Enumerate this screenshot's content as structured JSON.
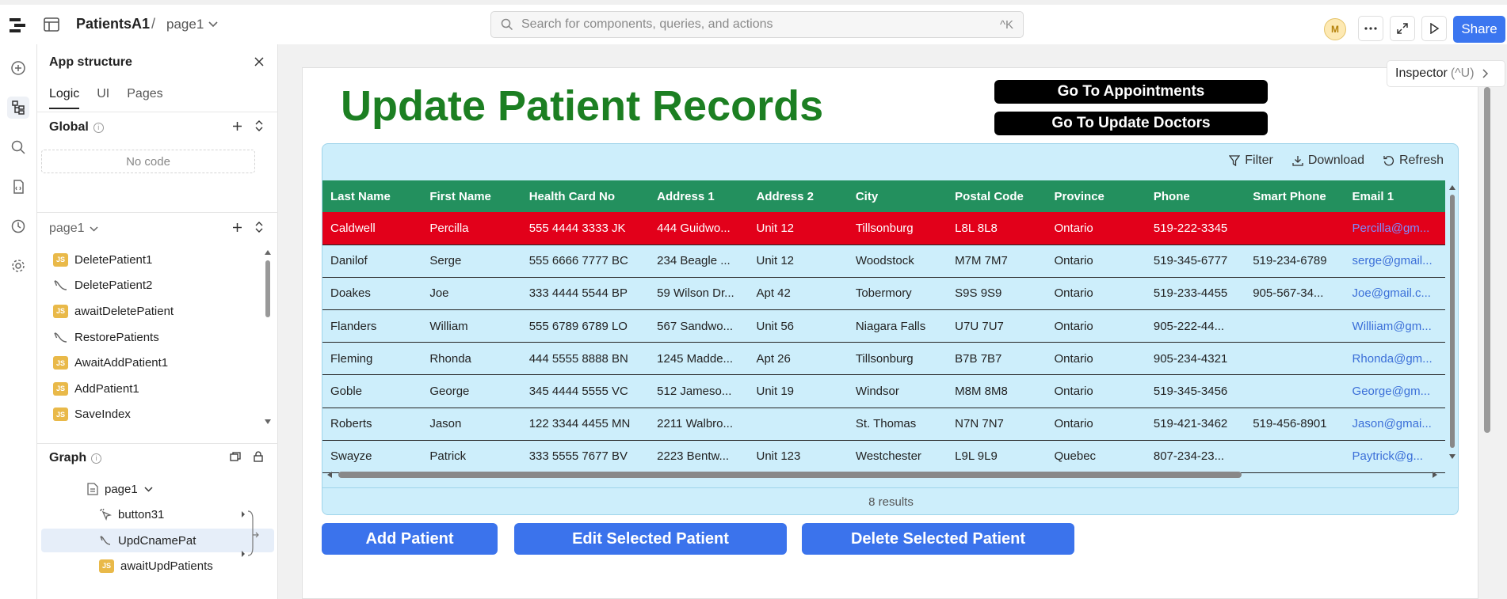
{
  "topbar": {
    "app_name": "PatientsA1",
    "separator": "/",
    "page_name": "page1",
    "search_placeholder": "Search for components, queries, and actions",
    "search_shortcut": "^K",
    "avatar_initial": "M",
    "share_label": "Share"
  },
  "panel": {
    "title": "App structure",
    "tabs": [
      "Logic",
      "UI",
      "Pages"
    ],
    "global_label": "Global",
    "no_code": "No code",
    "page_label": "page1",
    "queries": [
      {
        "type": "js",
        "name": "DeletePatient1"
      },
      {
        "type": "query",
        "name": "DeletePatient2"
      },
      {
        "type": "js",
        "name": "awaitDeletePatient"
      },
      {
        "type": "query",
        "name": "RestorePatients"
      },
      {
        "type": "js",
        "name": "AwaitAddPatient1"
      },
      {
        "type": "js",
        "name": "AddPatient1"
      },
      {
        "type": "js",
        "name": "SaveIndex"
      }
    ],
    "graph_label": "Graph",
    "graph_page": "page1",
    "graph_items": [
      "button31",
      "UpdCnamePat",
      "awaitUpdPatients"
    ]
  },
  "canvas": {
    "heading": "Update Patient Records",
    "btn_appointments": "Go To Appointments",
    "btn_doctors": "Go To Update Doctors",
    "inspector_label": "Inspector",
    "inspector_shortcut": "(^U)"
  },
  "table": {
    "toolbar": {
      "filter": "Filter",
      "download": "Download",
      "refresh": "Refresh"
    },
    "columns": [
      "Last Name",
      "First Name",
      "Health Card No",
      "Address 1",
      "Address 2",
      "City",
      "Postal Code",
      "Province",
      "Phone",
      "Smart Phone",
      "Email 1"
    ],
    "rows": [
      [
        "Caldwell",
        "Percilla",
        "555 4444 3333 JK",
        "444 Guidwo...",
        "Unit 12",
        "Tillsonburg",
        "L8L 8L8",
        "Ontario",
        "519-222-3345",
        "",
        "Percilla@gm..."
      ],
      [
        "Danilof",
        "Serge",
        "555 6666 7777 BC",
        "234 Beagle ...",
        "Unit 12",
        "Woodstock",
        "M7M 7M7",
        "Ontario",
        "519-345-6777",
        "519-234-6789",
        "serge@gmail..."
      ],
      [
        "Doakes",
        "Joe",
        "333 4444 5544 BP",
        "59 Wilson Dr...",
        "Apt 42",
        "Tobermory",
        "S9S 9S9",
        "Ontario",
        "519-233-4455",
        "905-567-34...",
        "Joe@gmail.c..."
      ],
      [
        "Flanders",
        "William",
        "555 6789 6789 LO",
        "567 Sandwo...",
        "Unit 56",
        "Niagara Falls",
        "U7U 7U7",
        "Ontario",
        "905-222-44...",
        "",
        "Williiam@gm..."
      ],
      [
        "Fleming",
        "Rhonda",
        "444 5555 8888 BN",
        "1245 Madde...",
        "Apt 26",
        "Tillsonburg",
        "B7B 7B7",
        "Ontario",
        "905-234-4321",
        "",
        "Rhonda@gm..."
      ],
      [
        "Goble",
        "George",
        "345 4444 5555 VC",
        "512 Jameso...",
        "Unit 19",
        "Windsor",
        "M8M 8M8",
        "Ontario",
        "519-345-3456",
        "",
        "George@gm..."
      ],
      [
        "Roberts",
        "Jason",
        "122 3344 4455 MN",
        "2211 Walbro...",
        "",
        "St. Thomas",
        "N7N 7N7",
        "Ontario",
        "519-421-3462",
        "519-456-8901",
        "Jason@gmai..."
      ],
      [
        "Swayze",
        "Patrick",
        "333 5555 7677 BV",
        "2223 Bentw...",
        "Unit 123",
        "Westchester",
        "L9L 9L9",
        "Quebec",
        "807-234-23...",
        "",
        "Paytrick@g..."
      ]
    ],
    "selected_row": 0,
    "results": "8 results"
  },
  "actions": {
    "add": "Add Patient",
    "edit": "Edit Selected Patient",
    "delete": "Delete Selected Patient"
  },
  "colors": {
    "heading_green": "#1c7f22",
    "header_green": "#23905e",
    "selected_red": "#e2001a",
    "table_bg": "#cdeefb",
    "primary_blue": "#3b73ec"
  }
}
